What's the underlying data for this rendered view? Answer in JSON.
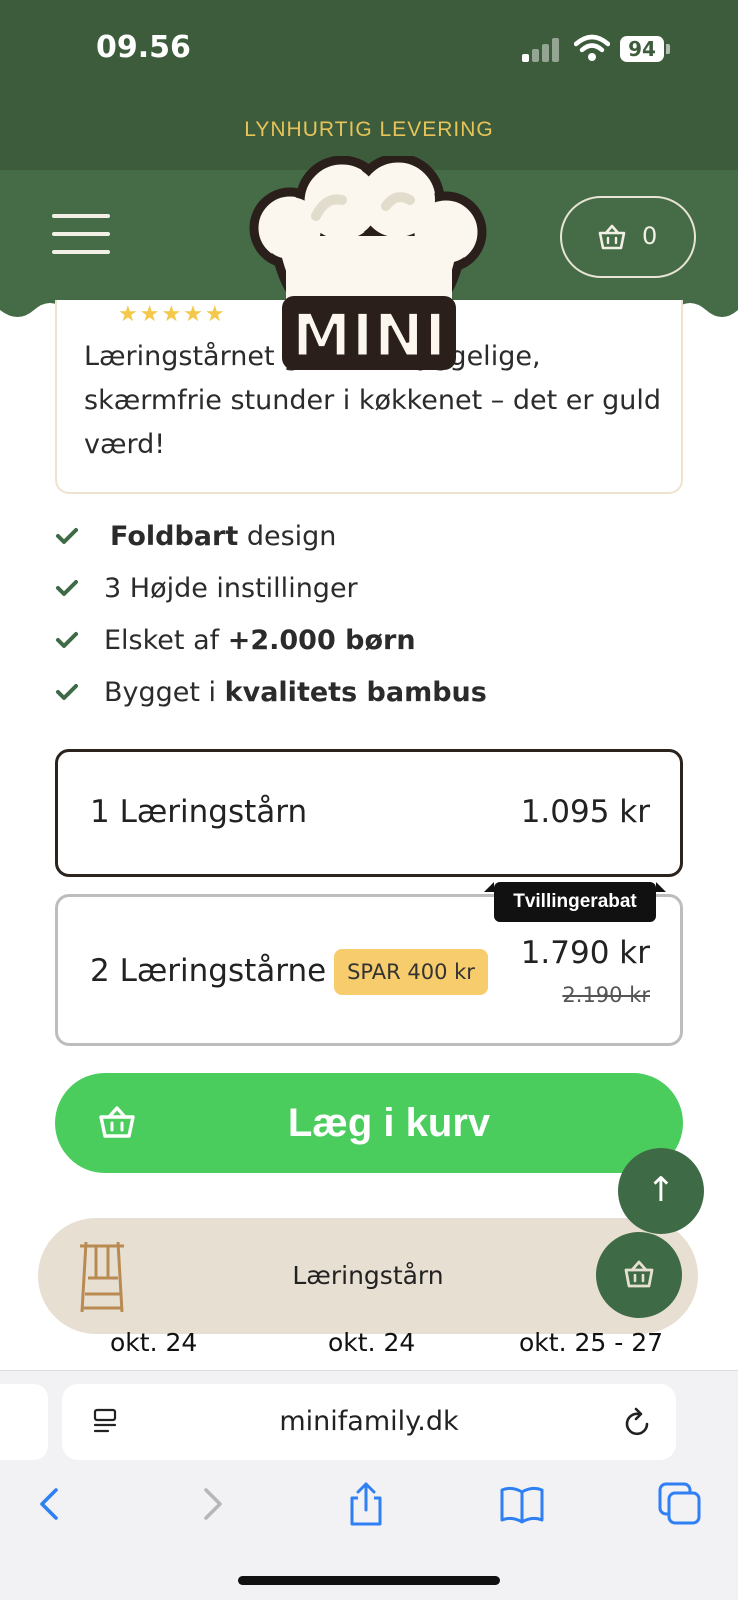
{
  "status_bar": {
    "time": "09.56",
    "battery": "94"
  },
  "banner": {
    "text": "LYNHURTIG LEVERING"
  },
  "header": {
    "cart_count": "0",
    "logo_text": "MINI"
  },
  "review": {
    "stars": "★★★★★",
    "text": "Læringstårnet giver os hyggelige, skærmfrie stunder i køkkenet – det er guld værd!"
  },
  "features": [
    {
      "bold": "Foldbart",
      "text": " design"
    },
    {
      "pre": "3 Højde instillinger"
    },
    {
      "pre": "Elsket af ",
      "bold": "+2.000 børn"
    },
    {
      "pre": "Bygget i ",
      "bold": "kvalitets bambus"
    }
  ],
  "options": [
    {
      "label": "1 Læringstårn",
      "price": "1.095 kr"
    },
    {
      "label": "2 Læringstårne",
      "badge": "SPAR 400 kr",
      "price": "1.790 kr",
      "old_price": "2.190 kr",
      "tag": "Tvillingerabat"
    }
  ],
  "add_to_cart": {
    "label": "Læg i kurv"
  },
  "scroll_top": {
    "icon": "↑"
  },
  "sticky_bar": {
    "product_name": "Læringstårn"
  },
  "delivery_dates": [
    "okt. 24",
    "okt. 24",
    "okt. 25 - 27"
  ],
  "browser": {
    "url": "minifamily.dk"
  },
  "colors": {
    "dark_green": "#3c5c3c",
    "header_green": "#456c46",
    "cta_green": "#4bcd5e",
    "gold": "#e8c35a",
    "badge_yellow": "#f6cc6c",
    "ios_blue": "#2f7ff5"
  }
}
